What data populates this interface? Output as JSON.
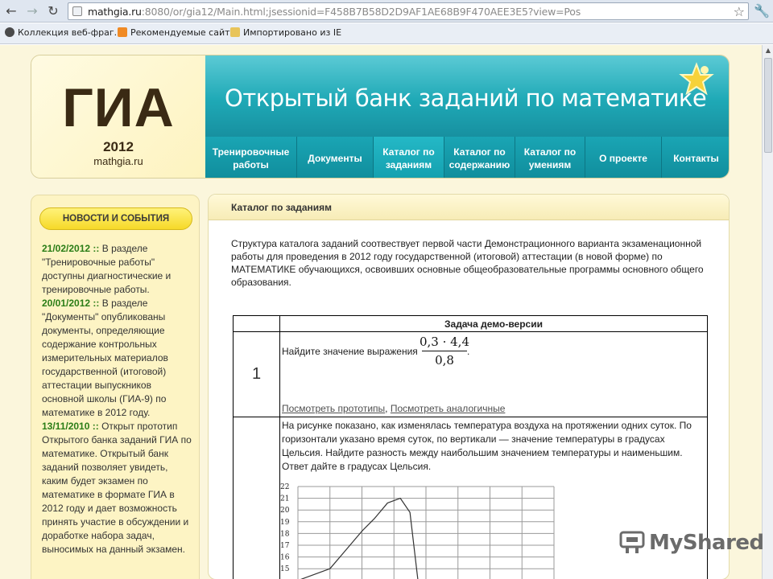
{
  "browser": {
    "url_host": "mathgia.ru",
    "url_rest": ":8080/or/gia12/Main.html;jsessionid=F458B7B58D2D9AF1AE68B9F470AEE3E5?view=Pos",
    "bookmarks": [
      "Коллекция веб-фраг...",
      "Рекомендуемые сайты",
      "Импортировано из IE"
    ]
  },
  "logo": {
    "title": "ГИА",
    "year": "2012",
    "site": "mathgia.ru"
  },
  "banner": {
    "title": "Открытый банк заданий по математике"
  },
  "menu": [
    "Тренировочные работы",
    "Документы",
    "Каталог по заданиям",
    "Каталог по содержанию",
    "Каталог по умениям",
    "О проекте",
    "Контакты"
  ],
  "news": {
    "heading": "НОВОСТИ И СОБЫТИЯ",
    "items": [
      {
        "date": "21/02/2012",
        "sep": " :: ",
        "text": "В разделе \"Тренировочные работы\" доступны диагностические и тренировочные работы."
      },
      {
        "date": "20/01/2012",
        "sep": " :: ",
        "text": "В разделе \"Документы\" опубликованы документы, определяющие содержание контрольных измерительных материалов государственной (итоговой) аттестации выпускников основной школы (ГИА-9) по математике в 2012 году."
      },
      {
        "date": "13/11/2010",
        "sep": " :: ",
        "text": "Открыт прототип Открытого банка заданий ГИА по математике. Открытый банк заданий позволяет увидеть, каким будет экзамен по математике в формате ГИА в 2012 году и дает возможность принять участие в обсуждении и доработке набора задач, выносимых на данный экзамен."
      }
    ]
  },
  "main": {
    "title": "Каталог по заданиям",
    "intro": "Структура каталога заданий соотвествует первой части Демонстрационного варианта экзаменационной работы для проведения в 2012 году государственной (итоговой) аттестации (в новой форме) по МАТЕМАТИКЕ обучающихся, освоивших основные общеобразовательные программы основного общего образования.",
    "table_header": "Задача демо-версии",
    "task1": {
      "number": "1",
      "text": "Найдите значение выражения",
      "numerator": "0,3 · 4,4",
      "denominator": "0,8",
      "dot": ".",
      "link1": "Посмотреть прототипы",
      "link_sep": ", ",
      "link2": "Посмотреть аналогичные"
    },
    "task2": {
      "text": "На рисунке показано, как изменялась температура воздуха на протяжении одних суток. По горизонтали указано время суток, по вертикали — значение температуры в градусах Цельсия. Найдите разность между наибольшим значением температуры и наименьшим. Ответ дайте в градусах Цельсия."
    }
  },
  "chart_data": {
    "type": "line",
    "y_ticks": [
      22,
      21,
      20,
      19,
      18,
      17,
      16,
      15
    ],
    "ylim": [
      14,
      22
    ],
    "grid": true,
    "series": [
      {
        "x": [
          0,
          1.0,
          1.5,
          2.0,
          2.4,
          2.8,
          3.2,
          3.5,
          3.75
        ],
        "y": [
          14,
          15,
          16.6,
          18.2,
          19.3,
          20.6,
          21.0,
          19.8,
          14
        ]
      }
    ]
  },
  "watermark": "MyShared"
}
